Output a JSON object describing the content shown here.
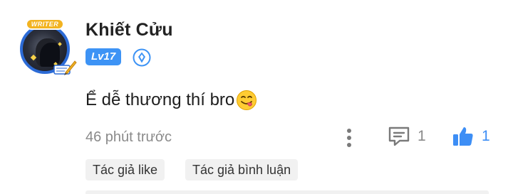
{
  "user": {
    "name": "Khiết Cửu",
    "level": "Lv17",
    "avatar_frame_label": "WRITER"
  },
  "comment": {
    "text": "Ể dễ thương thí bro",
    "emoji": "yum-face-emoji"
  },
  "meta": {
    "time": "46 phút trước",
    "reply_count": "1",
    "like_count": "1"
  },
  "tags": [
    "Tác giả like",
    "Tác giả bình luận"
  ],
  "colors": {
    "accent": "#3d93f5",
    "muted_text": "#8a8a8a",
    "tag_bg": "#f1f1f1"
  }
}
